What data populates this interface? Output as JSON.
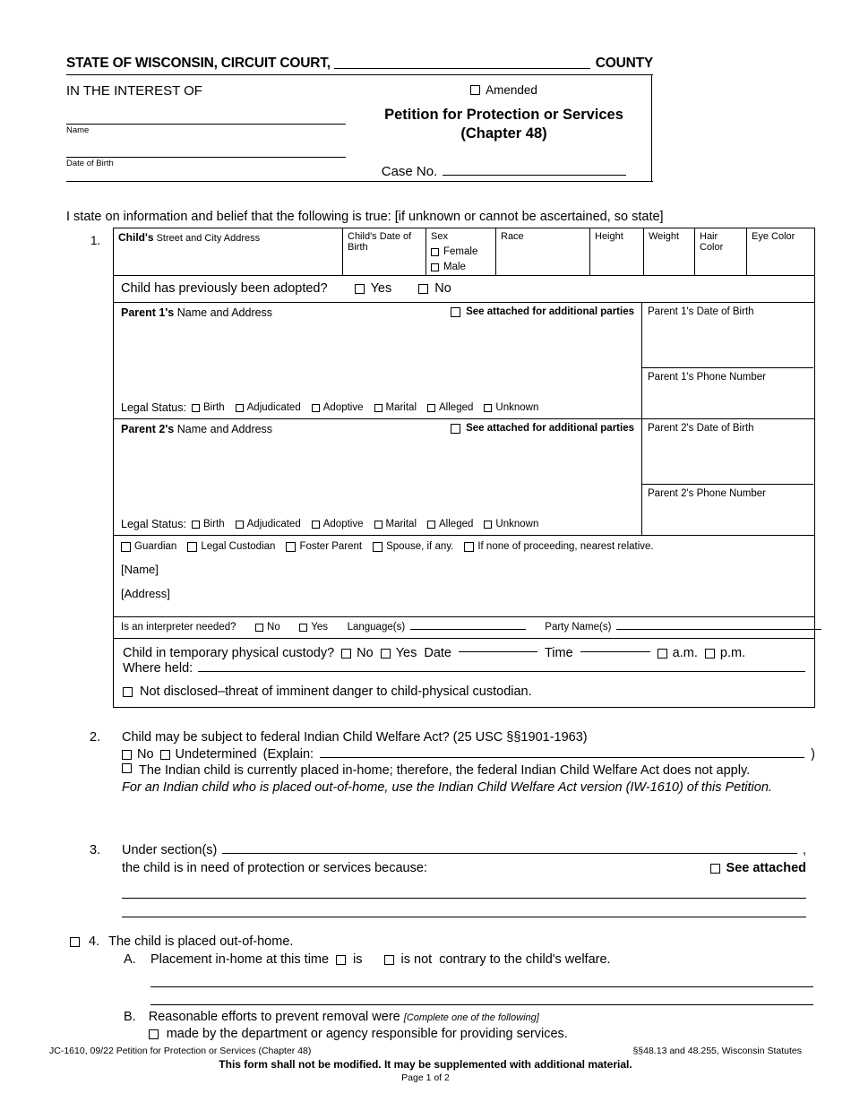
{
  "header": {
    "state_line": "STATE OF WISCONSIN, CIRCUIT COURT,",
    "county_label": "COUNTY",
    "in_the_interest_of": "IN THE INTEREST OF",
    "name_caption": "Name",
    "dob_caption": "Date of Birth",
    "amended_label": "Amended",
    "title_line1": "Petition for Protection or Services",
    "title_line2": "(Chapter 48)",
    "case_no_label": "Case No."
  },
  "intro": "I state on information and belief that the following is true: [if unknown or cannot be ascertained, so state]",
  "item1": {
    "number": "1.",
    "child_columns": {
      "address_bold": "Child's",
      "address_rest": "Street and City Address",
      "dob": "Child's Date of Birth",
      "sex": "Sex",
      "sex_female": "Female",
      "sex_male": "Male",
      "race": "Race",
      "height": "Height",
      "weight": "Weight",
      "hair_color": "Hair Color",
      "eye_color": "Eye Color"
    },
    "adopted_question": "Child has previously been adopted?",
    "adopted_yes": "Yes",
    "adopted_no": "No",
    "parent1": {
      "name_bold": "Parent 1's",
      "name_rest": "Name and Address",
      "see_attached": "See attached for additional parties",
      "dob_label": "Parent 1's Date of Birth",
      "phone_label": "Parent 1's Phone Number",
      "legal_status_label": "Legal Status:",
      "legal_options": [
        "Birth",
        "Adjudicated",
        "Adoptive",
        "Marital",
        "Alleged",
        "Unknown"
      ]
    },
    "parent2": {
      "name_bold": "Parent 2's",
      "name_rest": "Name and Address",
      "see_attached": "See attached for additional parties",
      "dob_label": "Parent 2's Date of Birth",
      "phone_label": "Parent 2's Phone Number",
      "legal_status_label": "Legal Status:",
      "legal_options": [
        "Birth",
        "Adjudicated",
        "Adoptive",
        "Marital",
        "Alleged",
        "Unknown"
      ]
    },
    "guardian": {
      "options": [
        "Guardian",
        "Legal Custodian",
        "Foster Parent",
        "Spouse, if any.",
        "If none of proceeding, nearest relative."
      ],
      "name_placeholder": "[Name]",
      "address_placeholder": "[Address]"
    },
    "interpreter": {
      "question": "Is an interpreter needed?",
      "no": "No",
      "yes": "Yes",
      "languages_label": "Language(s)",
      "party_names_label": "Party Name(s)"
    },
    "custody": {
      "question": "Child in temporary physical custody?",
      "no": "No",
      "yes": "Yes",
      "date_label": "Date",
      "time_label": "Time",
      "am": "a.m.",
      "pm": "p.m.",
      "where_held_label": "Where held:",
      "not_disclosed": "Not disclosed–threat of imminent danger to child-physical custodian."
    }
  },
  "item2": {
    "number": "2.",
    "question": "Child may be subject to federal Indian Child Welfare Act? (25 USC §§1901-1963)",
    "no": "No",
    "undetermined": "Undetermined",
    "explain_open": "(Explain:",
    "explain_close": ")",
    "in_home": "The Indian child is currently placed in-home; therefore, the federal Indian Child Welfare Act does not apply.",
    "italic_note": "For an Indian child who is placed out-of-home, use the Indian Child Welfare Act version (IW-1610) of this Petition."
  },
  "item3": {
    "number": "3.",
    "under_sections": "Under section(s)",
    "comma": ",",
    "because": "the child is in need of protection or services because:",
    "see_attached": "See attached"
  },
  "item4": {
    "number": "4.",
    "heading": "The child is placed out-of-home.",
    "a_letter": "A.",
    "a_text_start": "Placement in-home at this time",
    "a_is": "is",
    "a_is_not": "is not",
    "a_text_end": "contrary to the child's welfare.",
    "b_letter": "B.",
    "b_text": "Reasonable efforts to prevent removal were",
    "b_italic": "[Complete one of the following]",
    "b_option1": "made by the department or agency responsible for providing services."
  },
  "footer": {
    "form_id": "JC-1610, 09/22 Petition for Protection or Services (Chapter 48)",
    "statutes": "§§48.13 and 48.255, Wisconsin Statutes",
    "notice": "This form shall not be modified. It may be supplemented with additional material.",
    "page": "Page 1 of 2"
  }
}
